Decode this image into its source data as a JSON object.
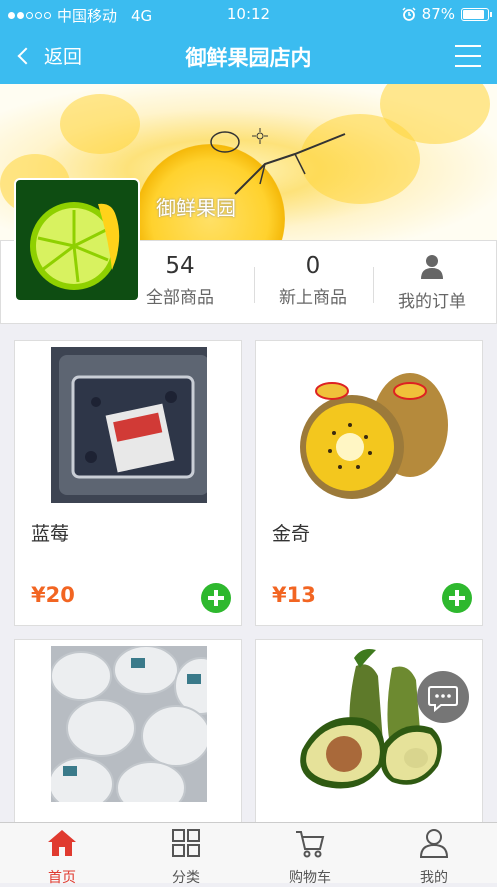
{
  "status_bar": {
    "carrier": "中国移动",
    "network": "4G",
    "time": "10:12",
    "battery": "87%",
    "battery_level": 0.87
  },
  "nav": {
    "back_label": "返回",
    "title": "御鲜果园店内"
  },
  "shop": {
    "name": "御鲜果园",
    "stats": [
      {
        "value": "54",
        "label": "全部商品"
      },
      {
        "value": "0",
        "label": "新上商品"
      }
    ],
    "orders_label": "我的订单"
  },
  "products": [
    {
      "name": "蓝莓",
      "price": "¥20"
    },
    {
      "name": "金奇",
      "price": "¥13"
    }
  ],
  "tabs": [
    {
      "label": "首页"
    },
    {
      "label": "分类"
    },
    {
      "label": "购物车"
    },
    {
      "label": "我的"
    }
  ],
  "colors": {
    "primary": "#3bbcf0",
    "price": "#f26522",
    "add": "#2eb82e",
    "active_tab": "#e03a2f"
  }
}
